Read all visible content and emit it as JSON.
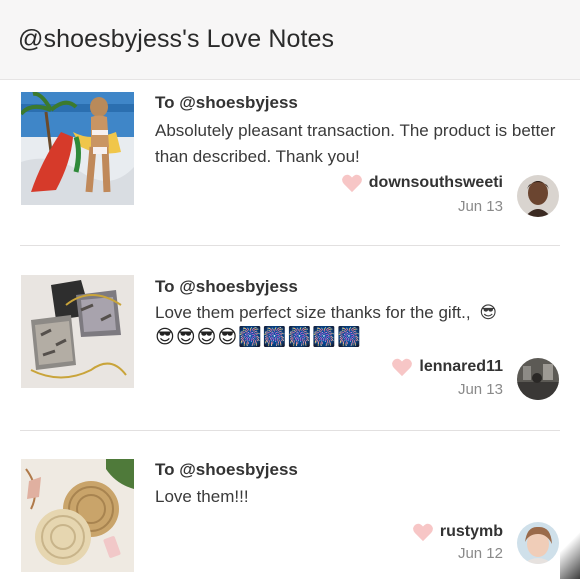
{
  "header": {
    "title": "@shoesbyjess's Love Notes"
  },
  "notes": [
    {
      "to": "To @shoesbyjess",
      "message": "Absolutely pleasant transaction. The product is better than described. Thank you!",
      "username": "downsouthsweeti",
      "date": "Jun 13",
      "thumb_icon": "beach-photo",
      "avatar_icon": "user-avatar"
    },
    {
      "to": "To @shoesbyjess",
      "message": "Love them perfect size thanks for the gift.,",
      "emojis": [
        "😎",
        "😎",
        "😎",
        "😎",
        "🎆",
        "🎆",
        "🎆",
        "🎆",
        "🎆"
      ],
      "username": "lennared11",
      "date": "Jun 13",
      "thumb_icon": "snakeskin-bags-photo",
      "avatar_icon": "user-avatar"
    },
    {
      "to": "To @shoesbyjess",
      "message": "Love them!!!",
      "username": "rustymb",
      "date": "Jun 12",
      "thumb_icon": "rattan-bags-photo",
      "avatar_icon": "user-avatar"
    }
  ],
  "colors": {
    "heart": "#f7c6c6",
    "header_bg": "#f7f6f6",
    "date_text": "#8a8a8a"
  }
}
